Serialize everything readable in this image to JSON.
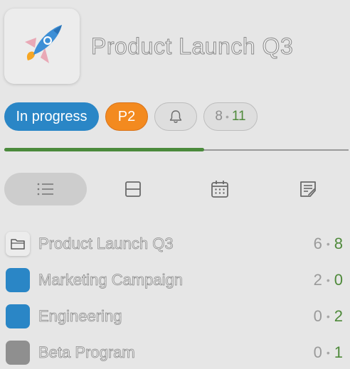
{
  "project": {
    "title": "Product Launch Q3",
    "icon": "rocket-icon"
  },
  "chips": {
    "status": "In progress",
    "priority": "P2",
    "alarm_icon": "bell-icon",
    "count_done": "8",
    "count_total": "11"
  },
  "colors": {
    "status_blue": "#2a86c6",
    "priority_orange": "#f38a1f",
    "progress_green": "#4b8a3c",
    "count_green": "#4f8a3b",
    "group_blue": "#2a86c6",
    "group_gray": "#8f8f8f"
  },
  "progress": {
    "fraction": 0.58
  },
  "view_tabs": [
    {
      "icon": "list-icon",
      "active": true
    },
    {
      "icon": "board-icon",
      "active": false
    },
    {
      "icon": "calendar-icon",
      "active": false
    },
    {
      "icon": "notes-icon",
      "active": false
    }
  ],
  "rows": [
    {
      "label": "Product Launch Q3",
      "icon": "folder-icon",
      "done": "6",
      "total": "8"
    },
    {
      "label": "Marketing Campaign",
      "icon": "color-swatch",
      "color": "#2a86c6",
      "done": "2",
      "total": "0"
    },
    {
      "label": "Engineering",
      "icon": "color-swatch",
      "color": "#2a86c6",
      "done": "0",
      "total": "2"
    },
    {
      "label": "Beta Program",
      "icon": "color-swatch",
      "color": "#8f8f8f",
      "done": "0",
      "total": "1"
    }
  ]
}
